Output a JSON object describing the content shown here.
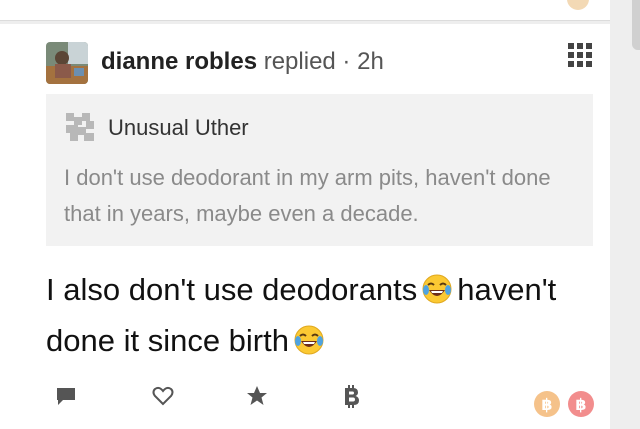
{
  "post": {
    "author_name": "dianne robles",
    "author_meta": "replied · 2h",
    "quote": {
      "author": "Unusual Uther",
      "text": "I don't use deodorant in my arm pits, haven't done that in years, maybe even a decade."
    },
    "body_part1": "I also don't use deodorants",
    "body_part2": "haven't done it since birth"
  },
  "icons": {
    "menu": "grid-menu-icon",
    "comment": "comment-icon",
    "like": "heart-icon",
    "favorite": "star-icon",
    "tip": "bitcoin-icon",
    "emoji": "tears-of-joy-emoji"
  },
  "coins": [
    {
      "symbol": "฿",
      "color": "#f5c28a"
    },
    {
      "symbol": "฿",
      "color": "#f28d8d"
    }
  ],
  "colors": {
    "accent_icon": "#555555",
    "quote_bg": "#f2f2f2"
  }
}
